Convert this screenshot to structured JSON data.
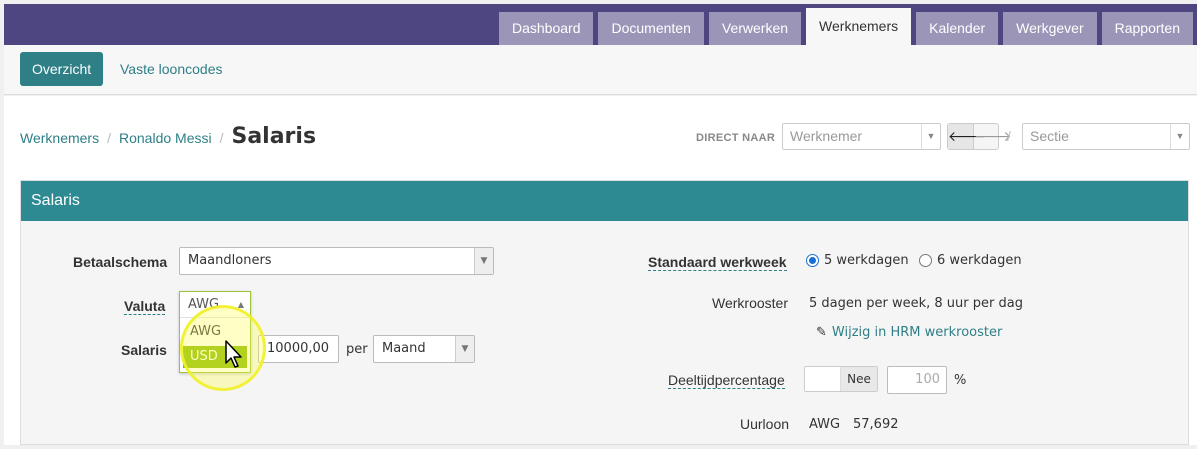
{
  "nav": {
    "tabs": [
      {
        "label": "Dashboard",
        "active": false
      },
      {
        "label": "Documenten",
        "active": false
      },
      {
        "label": "Verwerken",
        "active": false
      },
      {
        "label": "Werknemers",
        "active": true
      },
      {
        "label": "Kalender",
        "active": false
      },
      {
        "label": "Werkgever",
        "active": false
      },
      {
        "label": "Rapporten",
        "active": false
      }
    ]
  },
  "subnav": {
    "overzicht": "Overzicht",
    "vaste_looncodes": "Vaste looncodes"
  },
  "breadcrumb": {
    "items": [
      "Werknemers",
      "Ronaldo Messi"
    ],
    "separator": "/",
    "current": "Salaris"
  },
  "direct": {
    "label": "DIRECT NAAR",
    "werknemer_placeholder": "Werknemer",
    "sectie_placeholder": "Sectie",
    "separator": "/"
  },
  "panel": {
    "title": "Salaris",
    "betaalschema": {
      "label": "Betaalschema",
      "value": "Maandloners"
    },
    "valuta": {
      "label": "Valuta",
      "value": "AWG",
      "options": [
        "AWG",
        "USD"
      ],
      "highlighted": "USD"
    },
    "salaris": {
      "label": "Salaris",
      "amount": "10000,00",
      "per_label": "per",
      "period": "Maand"
    },
    "werkweek": {
      "label": "Standaard werkweek",
      "option1": "5 werkdagen",
      "option2": "6 werkdagen",
      "selected": "5 werkdagen"
    },
    "werkrooster": {
      "label": "Werkrooster",
      "value": "5 dagen per week, 8 uur per dag",
      "edit_link": "Wijzig in HRM werkrooster"
    },
    "deeltijd": {
      "label": "Deeltijdpercentage",
      "toggle_state": "Nee",
      "percent_placeholder": "100",
      "percent_sign": "%"
    },
    "uurloon": {
      "label": "Uurloon",
      "currency": "AWG",
      "value": "57,692"
    }
  },
  "colors": {
    "nav_bg": "#4d4680",
    "tab_bg": "#9b95b8",
    "teal": "#2e7f86",
    "panel_head": "#2d8a93",
    "dropdown_highlight": "#8ab800"
  }
}
